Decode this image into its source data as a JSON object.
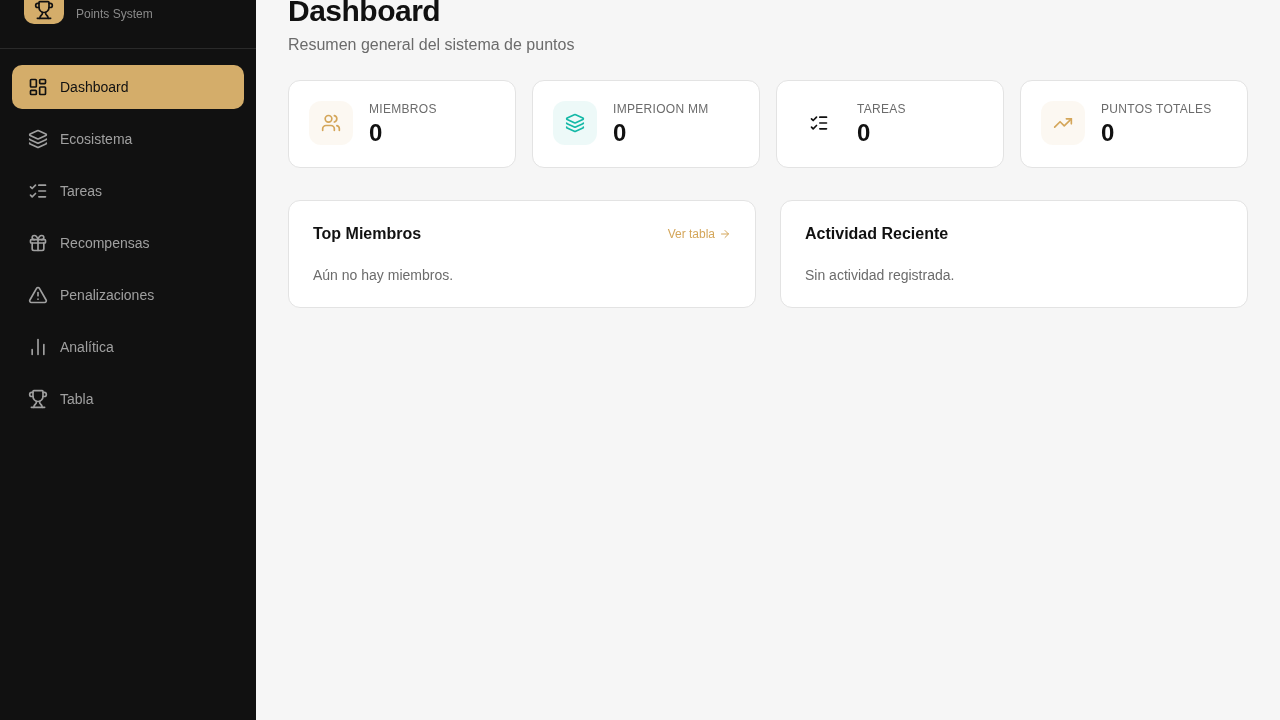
{
  "sidebar": {
    "brand_subtitle": "Points System",
    "items": [
      {
        "label": "Dashboard",
        "kind": "dashboard",
        "selected": true
      },
      {
        "label": "Ecosistema",
        "kind": "layers",
        "selected": false
      },
      {
        "label": "Tareas",
        "kind": "tasks",
        "selected": false
      },
      {
        "label": "Recompensas",
        "kind": "gift",
        "selected": false
      },
      {
        "label": "Penalizaciones",
        "kind": "alert",
        "selected": false
      },
      {
        "label": "Analítica",
        "kind": "chart",
        "selected": false
      },
      {
        "label": "Tabla",
        "kind": "trophy",
        "selected": false
      }
    ]
  },
  "header": {
    "title": "Dashboard",
    "subtitle": "Resumen general del sistema de puntos"
  },
  "stats": [
    {
      "label": "MIEMBROS",
      "value": "0",
      "kind": "users",
      "color": "#d4a65a"
    },
    {
      "label": "IMPERIOON MM",
      "value": "0",
      "kind": "layers",
      "color": "#14b8a6"
    },
    {
      "label": "TAREAS",
      "value": "0",
      "kind": "tasks",
      "color": "#111111"
    },
    {
      "label": "PUNTOS TOTALES",
      "value": "0",
      "kind": "trend",
      "color": "#d4a65a"
    }
  ],
  "panels": [
    {
      "title": "Top Miembros",
      "link": "Ver tabla",
      "empty": "Aún no hay miembros."
    },
    {
      "title": "Actividad Reciente",
      "empty": "Sin actividad registrada."
    }
  ]
}
